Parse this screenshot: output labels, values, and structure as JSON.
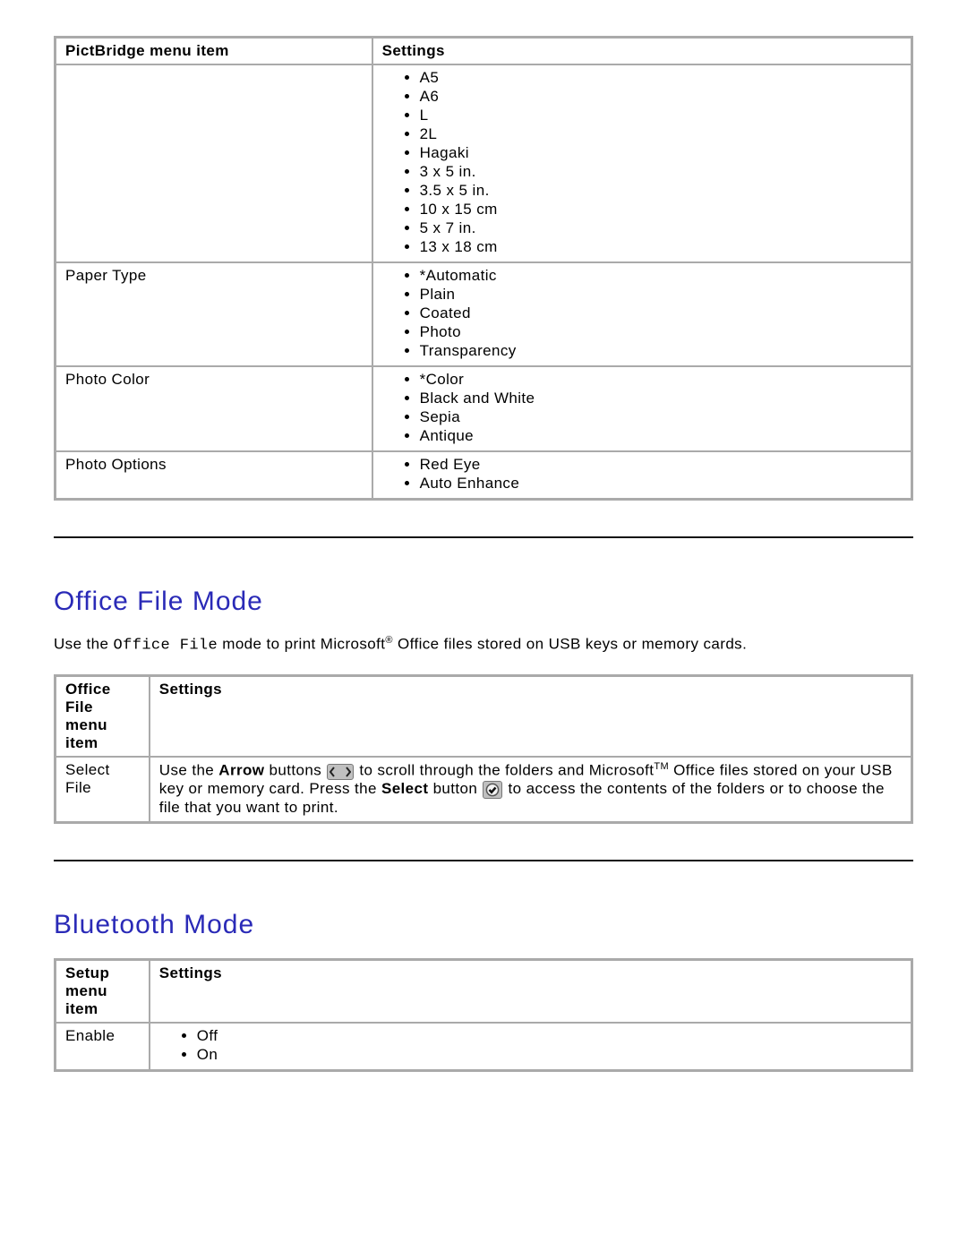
{
  "pictbridge": {
    "header_item": "PictBridge menu item",
    "header_settings": "Settings",
    "rows": {
      "r0": {
        "item": "",
        "opts": [
          "A5",
          "A6",
          "L",
          "2L",
          "Hagaki",
          "3 x 5 in.",
          "3.5 x 5 in.",
          "10 x 15 cm",
          "5 x 7 in.",
          "13 x 18 cm"
        ]
      },
      "r1": {
        "item": "Paper Type",
        "opts": [
          "*Automatic",
          "Plain",
          "Coated",
          "Photo",
          "Transparency"
        ]
      },
      "r2": {
        "item": "Photo Color",
        "opts": [
          "*Color",
          "Black and White",
          "Sepia",
          "Antique"
        ]
      },
      "r3": {
        "item": "Photo Options",
        "opts": [
          "Red Eye",
          "Auto Enhance"
        ]
      }
    }
  },
  "office": {
    "heading": "Office File Mode",
    "desc_prefix": "Use the ",
    "desc_mono": "Office File",
    "desc_mid": " mode to print Microsoft",
    "desc_reg": "®",
    "desc_suffix": " Office files stored on USB keys or memory cards.",
    "header_item": "Office File menu item",
    "header_settings": "Settings",
    "row1_item": "Select File",
    "row1_prefix": "Use the ",
    "row1_arrow_label": "Arrow",
    "row1_after_arrow_label": " buttons ",
    "row1_mid1": " to scroll through the folders and Microsoft",
    "row1_tm": "TM",
    "row1_mid2": " Office files stored on your USB key or memory card. Press the ",
    "row1_select_label": "Select",
    "row1_after_select_label": " button ",
    "row1_suffix": " to access the contents of the folders or to choose the file that you want to print."
  },
  "bluetooth": {
    "heading": "Bluetooth Mode",
    "header_item": "Setup menu item",
    "header_settings": "Settings",
    "row1_item": "Enable",
    "row1_opts": [
      "Off",
      "On"
    ]
  }
}
